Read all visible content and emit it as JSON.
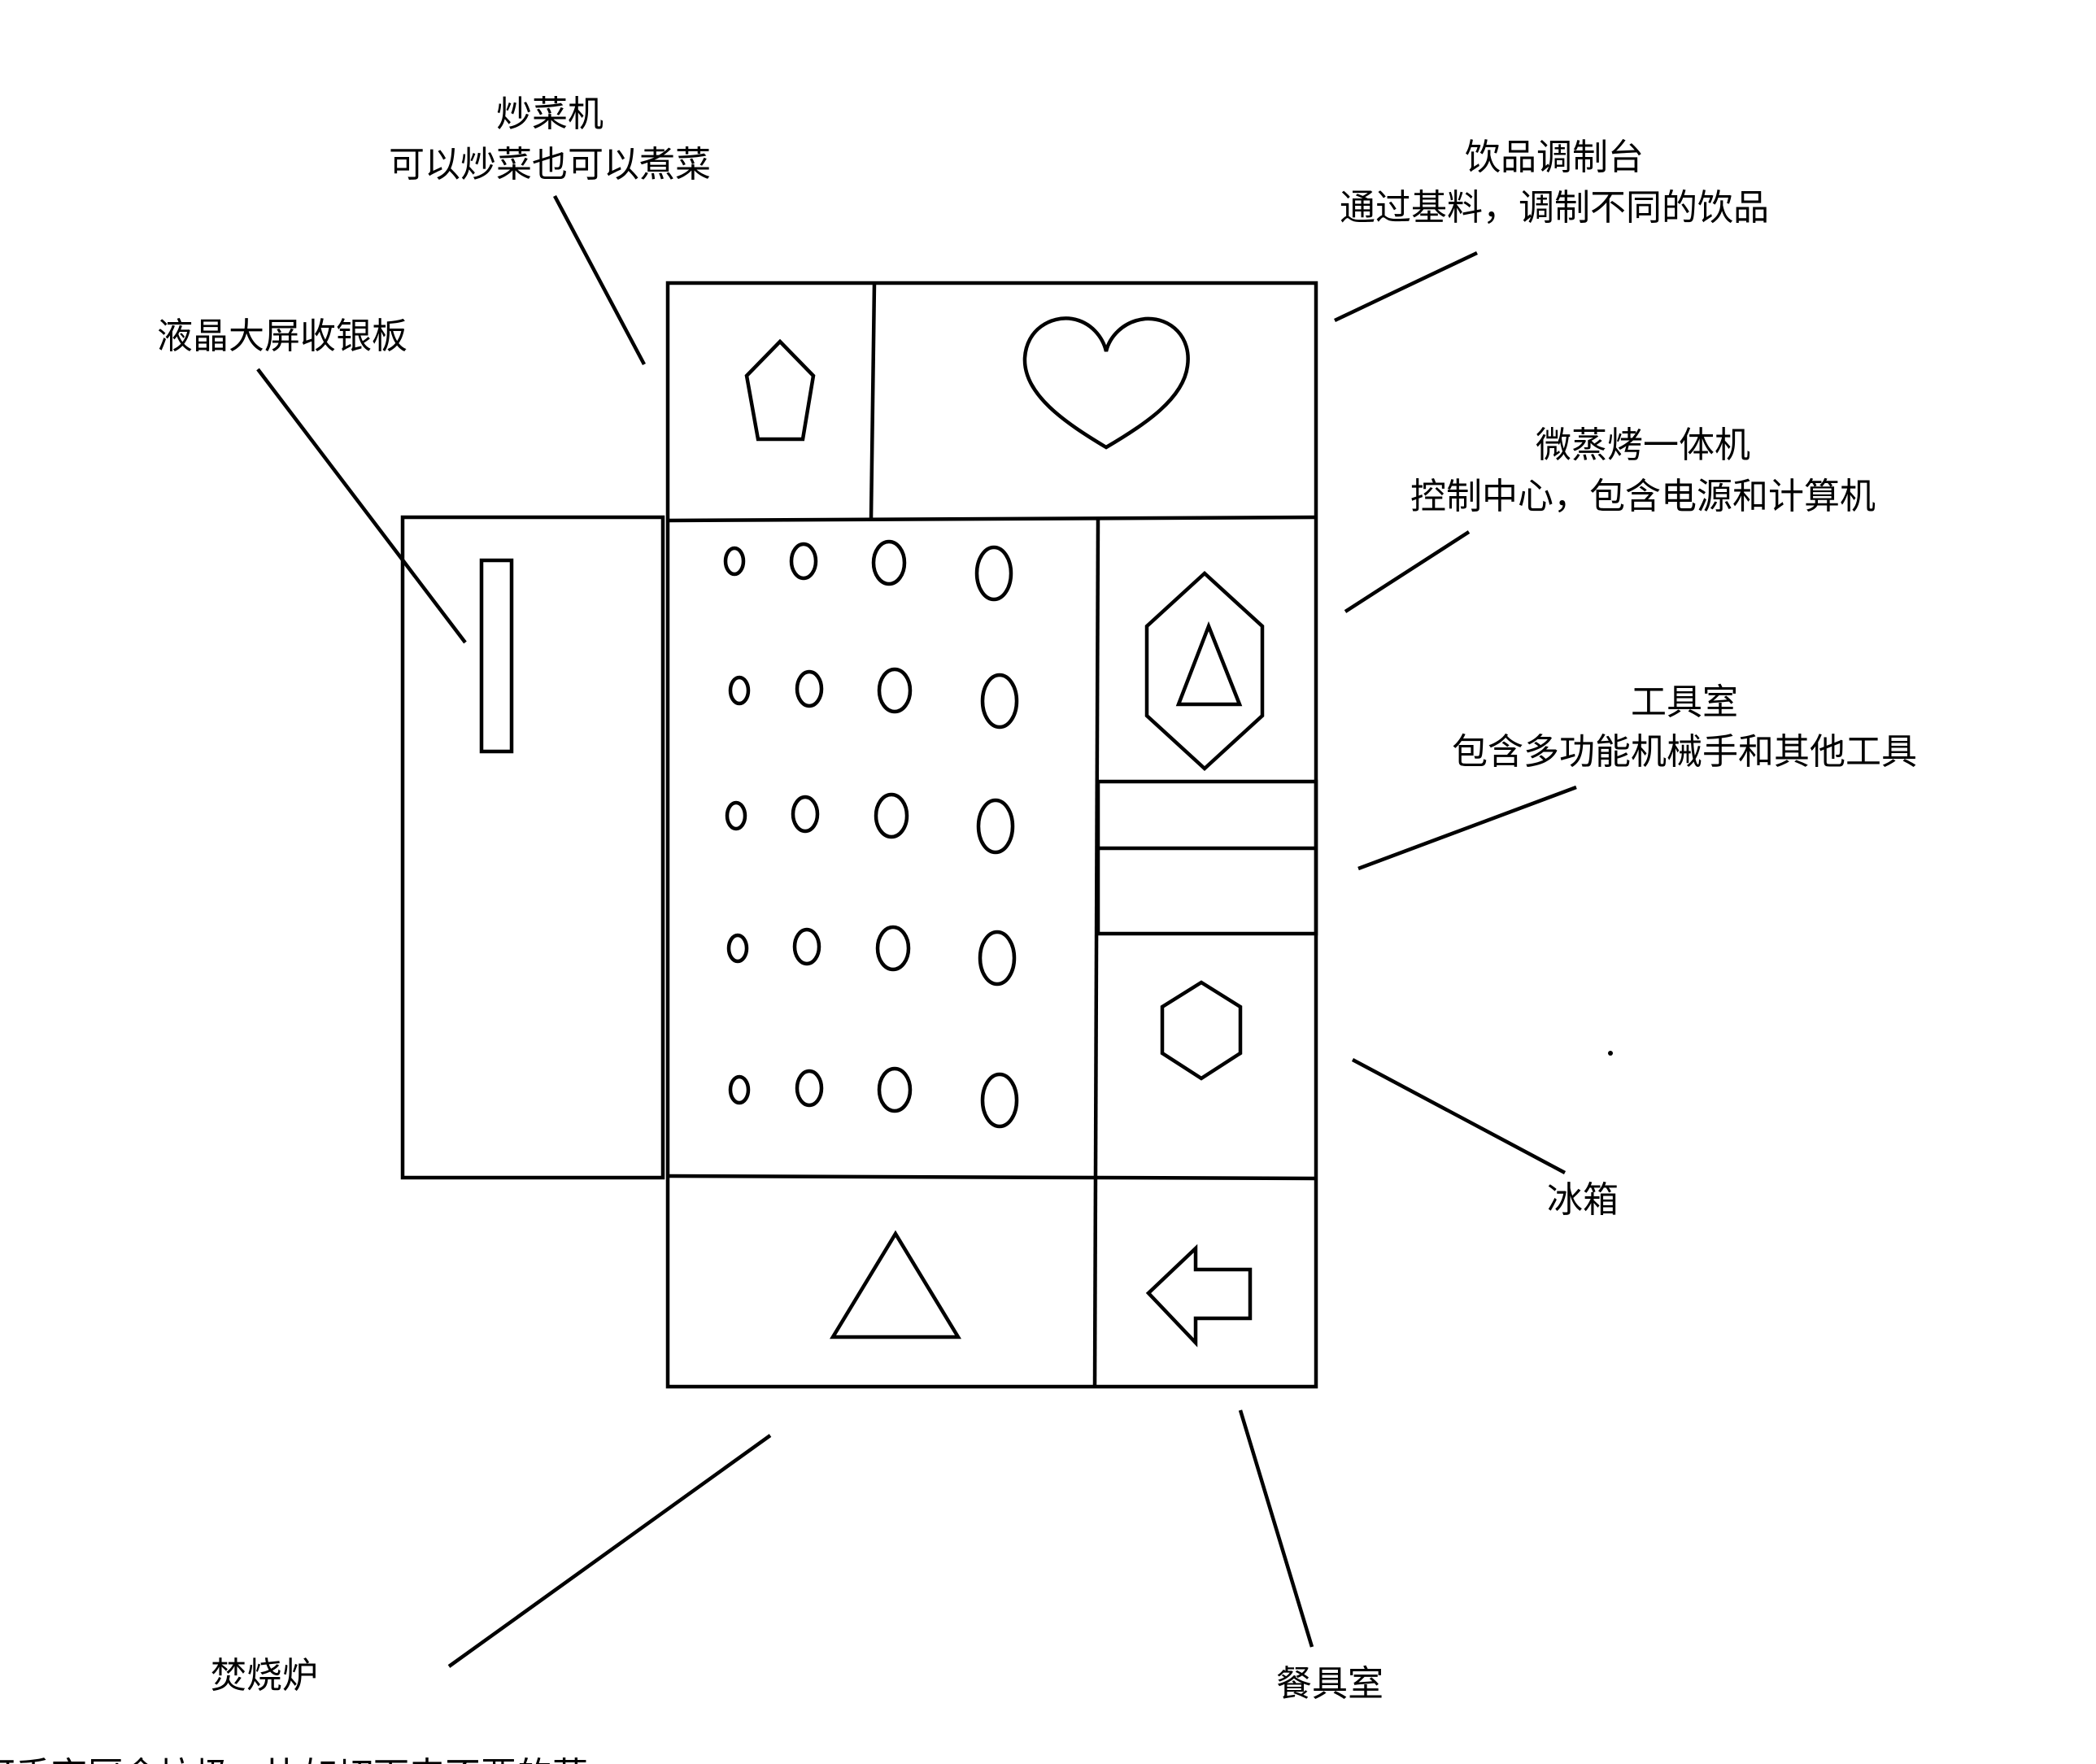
{
  "labels": {
    "stir_fry_machine": {
      "title": "炒菜机",
      "desc": "可以炒菜也可以煮菜"
    },
    "drink_station": {
      "title": "饮品调制台",
      "desc": "通过基料，调制不同的饮品"
    },
    "lcd_cashier": {
      "title": "液晶大屏收银板"
    },
    "combi_oven": {
      "title": "微蒸烤一体机",
      "desc": "控制中心，包含电源和计算机"
    },
    "tool_room": {
      "title": "工具室",
      "desc": "包含多功能机械手和其他工具"
    },
    "fridge": {
      "title": "冰箱"
    },
    "incinerator": {
      "title": "焚烧炉",
      "desc": "可手弃厨余垃圾，比如切下来不要的菜"
    },
    "tableware_room": {
      "title": "餐具室"
    }
  },
  "icons": {
    "stir_fry_machine": "pentagon-icon",
    "drink_station": "heart-icon",
    "cooking_area": "burner-dots-icon",
    "combi_oven": "hexagon-triangle-icon",
    "fridge": "hexagon-icon",
    "incinerator": "triangle-icon",
    "tableware_room": "arrow-left-icon",
    "lcd_cashier": "screen-slot-icon"
  },
  "colors": {
    "line": "#000000",
    "background": "#ffffff"
  }
}
